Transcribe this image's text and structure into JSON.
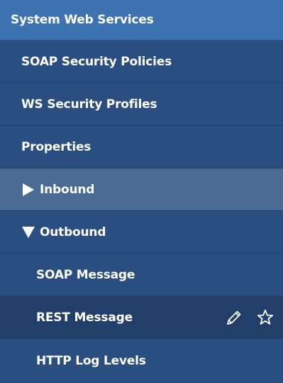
{
  "colors": {
    "header_bg": "#3e73b2",
    "menu_bg": "#294e7f",
    "hover_bg": "#4a6b94",
    "selected_bg": "#223f69",
    "text": "#ffffff"
  },
  "header": {
    "title": "System Web Services"
  },
  "menu": {
    "items": [
      {
        "label": "SOAP Security Policies"
      },
      {
        "label": "WS Security Profiles"
      },
      {
        "label": "Properties"
      },
      {
        "label": "Inbound",
        "expand_icon": "triangle-right-icon"
      },
      {
        "label": "Outbound",
        "expand_icon": "triangle-down-icon"
      },
      {
        "label": "SOAP Message"
      },
      {
        "label": "REST Message",
        "actions": [
          "pencil-icon",
          "star-icon"
        ]
      },
      {
        "label": "HTTP Log Levels"
      }
    ]
  }
}
